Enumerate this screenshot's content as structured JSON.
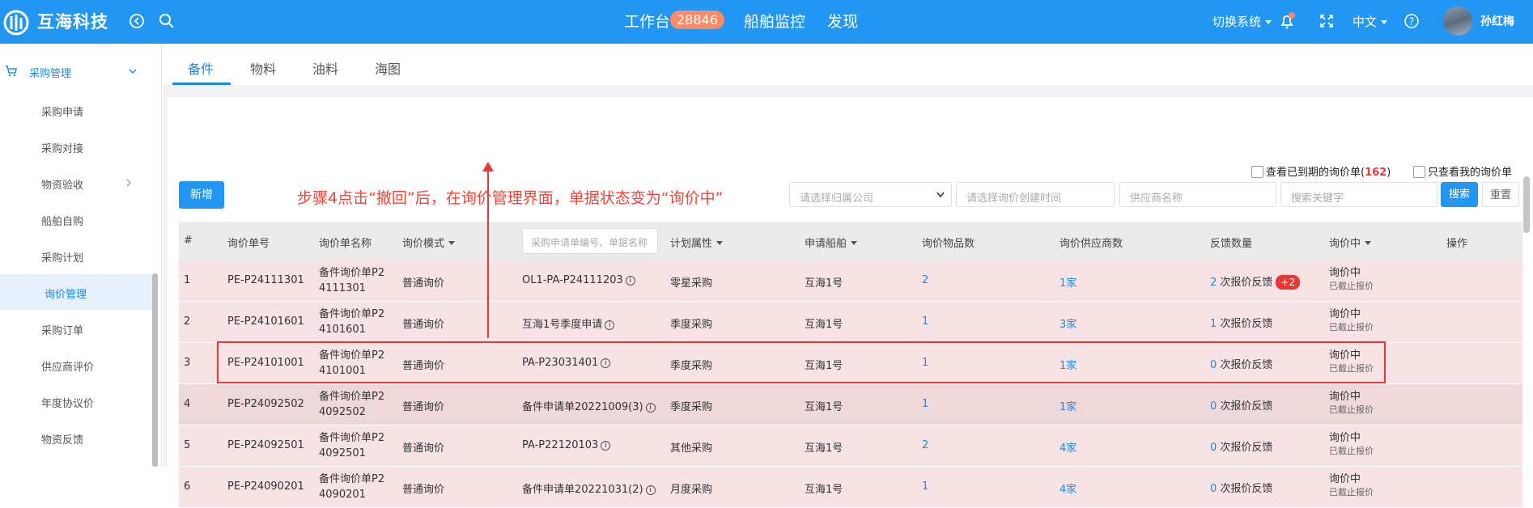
{
  "header": {
    "brand": "互海科技",
    "nav": [
      "工作台",
      "船舶监控",
      "发现"
    ],
    "badge": "28846",
    "switch_system": "切换系统",
    "language": "中文",
    "username": "孙红梅",
    "icons": [
      "back-icon",
      "search-icon",
      "bell-icon",
      "fullscreen-icon",
      "help-icon"
    ]
  },
  "sidebar": {
    "group": "采购管理",
    "items": [
      "采购申请",
      "采购对接",
      "物资验收",
      "船舶自购",
      "采购计划",
      "询价管理",
      "采购订单",
      "供应商评价",
      "年度协议价",
      "物资反馈"
    ],
    "active": "询价管理"
  },
  "tabs": [
    "备件",
    "物料",
    "油料",
    "海图"
  ],
  "filters": {
    "expired_label": "查看已到期的询价单(",
    "expired_count": "162",
    "expired_close": ")",
    "mine_label": "只查看我的询价单",
    "add_button": "新增",
    "company_placeholder": "请选择归属公司",
    "time_placeholder": "请选择询价创建时间",
    "supplier_placeholder": "供应商名称",
    "keyword_placeholder": "搜索关键字",
    "search_button": "搜索",
    "reset_button": "重置"
  },
  "annotation": "步骤4点击“撤回”后，在询价管理界面，单据状态变为“询价中”",
  "table": {
    "headers": {
      "idx": "#",
      "no": "询价单号",
      "name": "询价单名称",
      "mode": "询价模式",
      "req_placeholder": "采购申请单编号、单据名称",
      "plan": "计划属性",
      "ship": "申请船舶",
      "items": "询价物品数",
      "suppliers": "询价供应商数",
      "feedback": "反馈数量",
      "status": "询价中",
      "ops": "操作"
    },
    "rows": [
      {
        "idx": "1",
        "no": "PE-P24111301",
        "name1": "备件询价单P2",
        "name2": "4111301",
        "mode": "普通询价",
        "req": "OL1-PA-P24111203",
        "plan": "零星采购",
        "ship": "互海1号",
        "items": "2",
        "suppliers": "1家",
        "fb_num": "2",
        "fb_text": "次报价反馈",
        "fb_extra": "+2",
        "status": "询价中",
        "status_sub": "已截止报价"
      },
      {
        "idx": "2",
        "no": "PE-P24101601",
        "name1": "备件询价单P2",
        "name2": "4101601",
        "mode": "普通询价",
        "req": "互海1号季度申请",
        "plan": "季度采购",
        "ship": "互海1号",
        "items": "1",
        "suppliers": "3家",
        "fb_num": "1",
        "fb_text": "次报价反馈",
        "fb_extra": "",
        "status": "询价中",
        "status_sub": "已截止报价"
      },
      {
        "idx": "3",
        "no": "PE-P24101001",
        "name1": "备件询价单P2",
        "name2": "4101001",
        "mode": "普通询价",
        "req": "PA-P23031401",
        "plan": "季度采购",
        "ship": "互海1号",
        "items": "1",
        "suppliers": "1家",
        "fb_num": "0",
        "fb_text": "次报价反馈",
        "fb_extra": "",
        "status": "询价中",
        "status_sub": "已截止报价"
      },
      {
        "idx": "4",
        "no": "PE-P24092502",
        "name1": "备件询价单P2",
        "name2": "4092502",
        "mode": "普通询价",
        "req": "备件申请单20221009(3)",
        "plan": "季度采购",
        "ship": "互海1号",
        "items": "1",
        "suppliers": "1家",
        "fb_num": "0",
        "fb_text": "次报价反馈",
        "fb_extra": "",
        "status": "询价中",
        "status_sub": "已截止报价"
      },
      {
        "idx": "5",
        "no": "PE-P24092501",
        "name1": "备件询价单P2",
        "name2": "4092501",
        "mode": "普通询价",
        "req": "PA-P22120103",
        "plan": "其他采购",
        "ship": "互海1号",
        "items": "2",
        "suppliers": "4家",
        "fb_num": "0",
        "fb_text": "次报价反馈",
        "fb_extra": "",
        "status": "询价中",
        "status_sub": "已截止报价"
      },
      {
        "idx": "6",
        "no": "PE-P24090201",
        "name1": "备件询价单P2",
        "name2": "4090201",
        "mode": "普通询价",
        "req": "备件申请单20221031(2)",
        "plan": "月度采购",
        "ship": "互海1号",
        "items": "1",
        "suppliers": "4家",
        "fb_num": "0",
        "fb_text": "次报价反馈",
        "fb_extra": "",
        "status": "询价中",
        "status_sub": "已截止报价"
      }
    ]
  }
}
